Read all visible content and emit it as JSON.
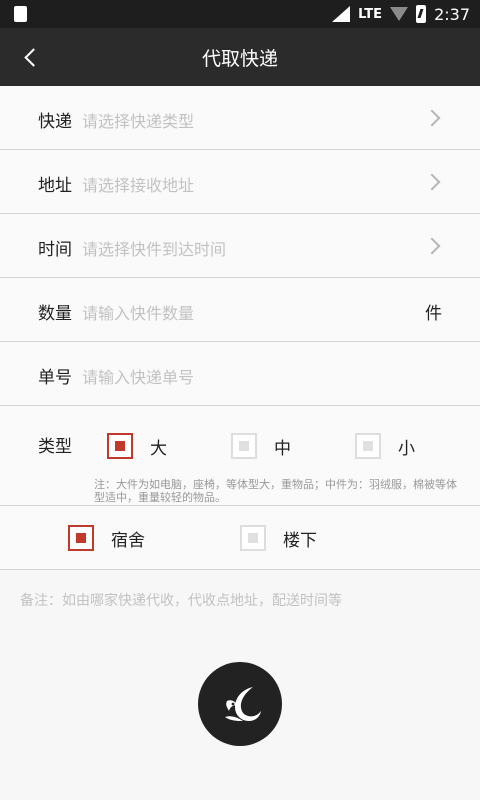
{
  "status": {
    "network": "LTE",
    "time": "2:37"
  },
  "header": {
    "title": "代取快递"
  },
  "fields": [
    {
      "label": "快递",
      "placeholder": "请选择快递类型",
      "has_chevron": true
    },
    {
      "label": "地址",
      "placeholder": "请选择接收地址",
      "has_chevron": true
    },
    {
      "label": "时间",
      "placeholder": "请选择快件到达时间",
      "has_chevron": true
    },
    {
      "label": "数量",
      "placeholder": "请输入快件数量",
      "unit": "件"
    },
    {
      "label": "单号",
      "placeholder": "请输入快递单号"
    }
  ],
  "type": {
    "label": "类型",
    "options": [
      {
        "label": "大",
        "checked": true
      },
      {
        "label": "中",
        "checked": false
      },
      {
        "label": "小",
        "checked": false
      }
    ],
    "note": "注：大件为如电脑，座椅，等体型大，重物品；中件为：羽绒服，棉被等体型适中，重量较轻的物品。"
  },
  "location": {
    "options": [
      {
        "label": "宿舍",
        "checked": true
      },
      {
        "label": "楼下",
        "checked": false
      }
    ]
  },
  "remark": {
    "placeholder": "备注：如由哪家快递代收，代收点地址，配送时间等"
  },
  "colors": {
    "accent": "#c0392b",
    "appbar": "#2b2b2b"
  },
  "fab": {
    "icon": "bird-logo-icon"
  }
}
